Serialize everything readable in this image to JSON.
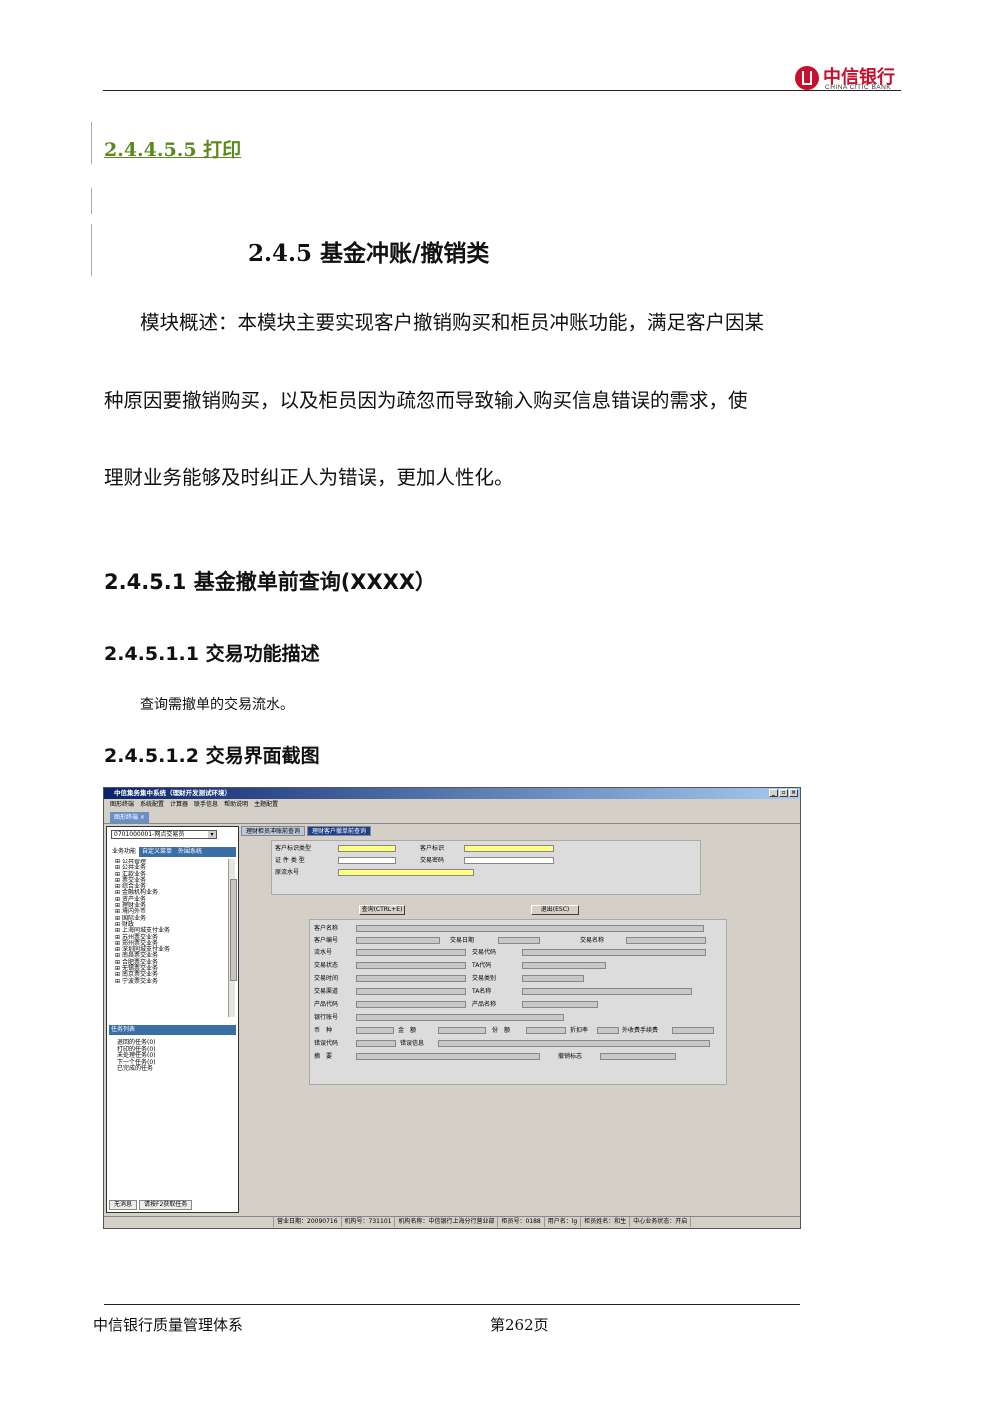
{
  "header": {
    "logo_cn": "中信银行",
    "logo_en": "CHINA CITIC BANK"
  },
  "section_print": "2.4.4.5.5 打印",
  "section_245": "2.4.5 基金冲账/撤销类",
  "overview": [
    "模块概述：本模块主要实现客户撤销购买和柜员冲账功能，满足客户因某",
    "种原因要撤销购买，以及柜员因为疏忽而导致输入购买信息错误的需求，使",
    "理财业务能够及时纠正人为错误，更加人性化。"
  ],
  "section_2451": "2.4.5.1 基金撤单前查询(XXXX）",
  "section_24511": "2.4.5.1.1 交易功能描述",
  "desc_text": "查询需撤单的交易流水。",
  "section_24512": "2.4.5.1.2 交易界面截图",
  "footer": {
    "left": "中信银行质量管理体系",
    "page": "第262页"
  },
  "screenshot": {
    "title": "中信集务集中系统（理财开发测试环境）",
    "menu": [
      "图形终端",
      "系统配置",
      "计算器",
      "联手信息",
      "帮助说明",
      "主题配置"
    ],
    "tab": "图形终端",
    "branch_combo": "0701000001-网点交易员",
    "left_tabs": [
      "业务功能",
      "自定义菜单",
      "外围系统"
    ],
    "tree_items": [
      "公共管理",
      "公共业务",
      "汇款业务",
      "票交业务",
      "综合业务",
      "金融机构业务",
      "资产业务",
      "理财业务",
      "境内外币",
      "国际业务",
      "财政",
      "上海同城支付业务",
      "苏州票交业务",
      "郑州票交业务",
      "深圳同城支付业务",
      "南昌票交业务",
      "合肥票交业务",
      "无锡票交业务",
      "南京票交业务",
      "宁波票交业务"
    ],
    "task_header": "任务列表",
    "tasks": [
      "退回的任务(0)",
      "打印的任务(0)",
      "未处理任务(0)",
      "下一个任务(0)",
      "已完成的任务"
    ],
    "left_status": [
      "无消息",
      "请按F2获取任务"
    ],
    "right_tabs": [
      "理财柜员冲账前查询",
      "理财客户撤单前查询"
    ],
    "query_labels": {
      "id_type": "客户标识类型",
      "cust_id": "客户标识",
      "cert_type": "证 件 类 型",
      "password": "交易密码",
      "serial": "原流水号"
    },
    "buttons": {
      "query": "查询(CTRL+E)",
      "exit": "退出(ESC)"
    },
    "result_labels": {
      "cust_name": "客户名称",
      "cust_no": "客户编号",
      "trade_date": "交易日期",
      "trade_name": "交易名称",
      "flow_no": "流水号",
      "trade_code": "交易代码",
      "trade_status": "交易状态",
      "ta_code": "TA代码",
      "trade_time": "交易时间",
      "trade_type": "交易类别",
      "trade_channel": "交易渠道",
      "ta_name": "TA名称",
      "product_code": "产品代码",
      "product_name": "产品名称",
      "bank_acct": "银行账号",
      "currency": "币　种",
      "amount": "金　额",
      "shares": "份　额",
      "discount": "折扣率",
      "fee": "外收费手续费",
      "err_code": "错误代码",
      "err_info": "错误信息",
      "summary": "摘　要",
      "cancel_flag": "撤销标志"
    },
    "status_bar": [
      "营业日期：20090716",
      "机构号：731101",
      "机构名称：中信银行上海分行营业部",
      "柜员号：0188",
      "用户名：lg",
      "柜员姓名：和生",
      "中心业务状态：开启"
    ]
  }
}
